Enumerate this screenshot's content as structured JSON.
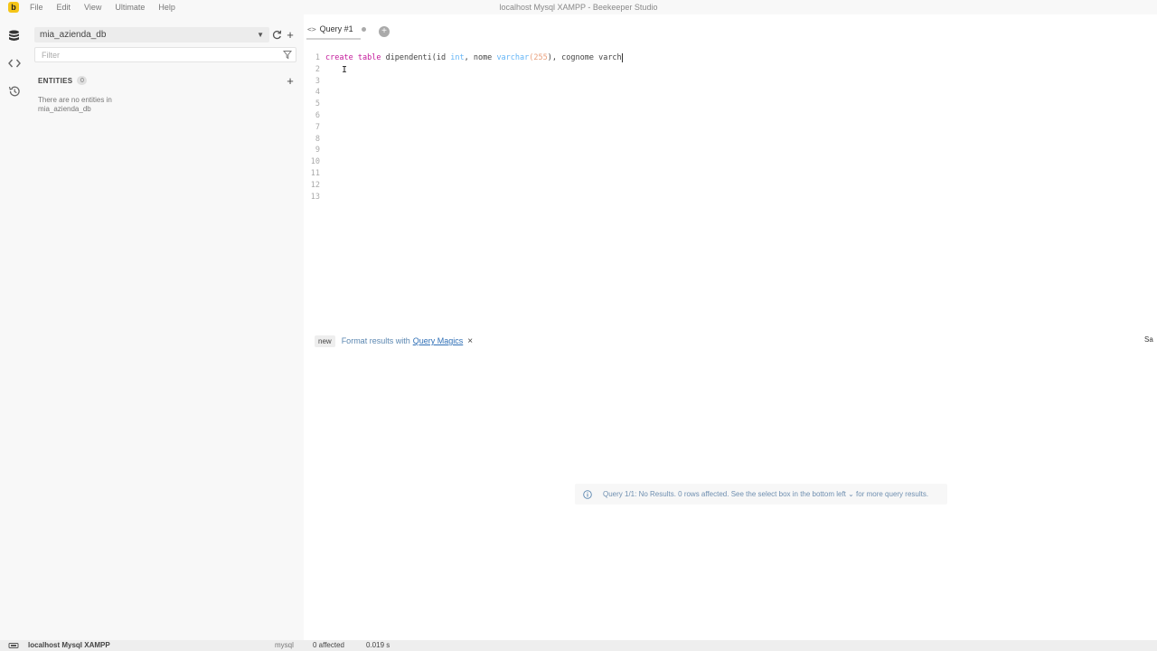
{
  "titlebar": {
    "logo_letter": "b",
    "menu": [
      "File",
      "Edit",
      "View",
      "Ultimate",
      "Help"
    ],
    "window_title": "localhost Mysql XAMPP - Beekeeper Studio"
  },
  "rail": {
    "icons": [
      "database-icon",
      "code-icon",
      "history-icon"
    ]
  },
  "sidebar": {
    "database": "mia_azienda_db",
    "filter_placeholder": "Filter",
    "entities_title": "ENTITIES",
    "entities_count": "0",
    "empty_line1": "There are no entities in",
    "empty_line2": "mia_azienda_db"
  },
  "tabs": [
    {
      "label": "Query #1",
      "active": true
    }
  ],
  "editor": {
    "line_numbers": [
      "1",
      "2",
      "3",
      "4",
      "5",
      "6",
      "7",
      "8",
      "9",
      "10",
      "11",
      "12",
      "13"
    ],
    "line1": {
      "create": "create",
      "table": "table",
      "name": "dipendenti(id",
      "type1": "int",
      "sep1": ",",
      "col2": "nome",
      "type2": "varchar",
      "paren_open": "(",
      "len": "255",
      "paren_close": "),",
      "col3": "cognome",
      "partial": "varch"
    }
  },
  "results": {
    "badge": "new",
    "text": "Format results with",
    "link": "Query Magics",
    "close": "×",
    "save_label": "Sa",
    "message": "Query 1/1: No Results. 0 rows affected. See the select box in the bottom left ⌄ for more query results."
  },
  "statusbar": {
    "connection": "localhost Mysql XAMPP",
    "dialect": "mysql",
    "affected": "0 affected",
    "time": "0.019 s"
  },
  "colors": {
    "keyword": "#c41a9b",
    "type": "#64b5f6",
    "number": "#e9a07d",
    "link": "#2f6fb6",
    "logo": "#f5c518"
  }
}
